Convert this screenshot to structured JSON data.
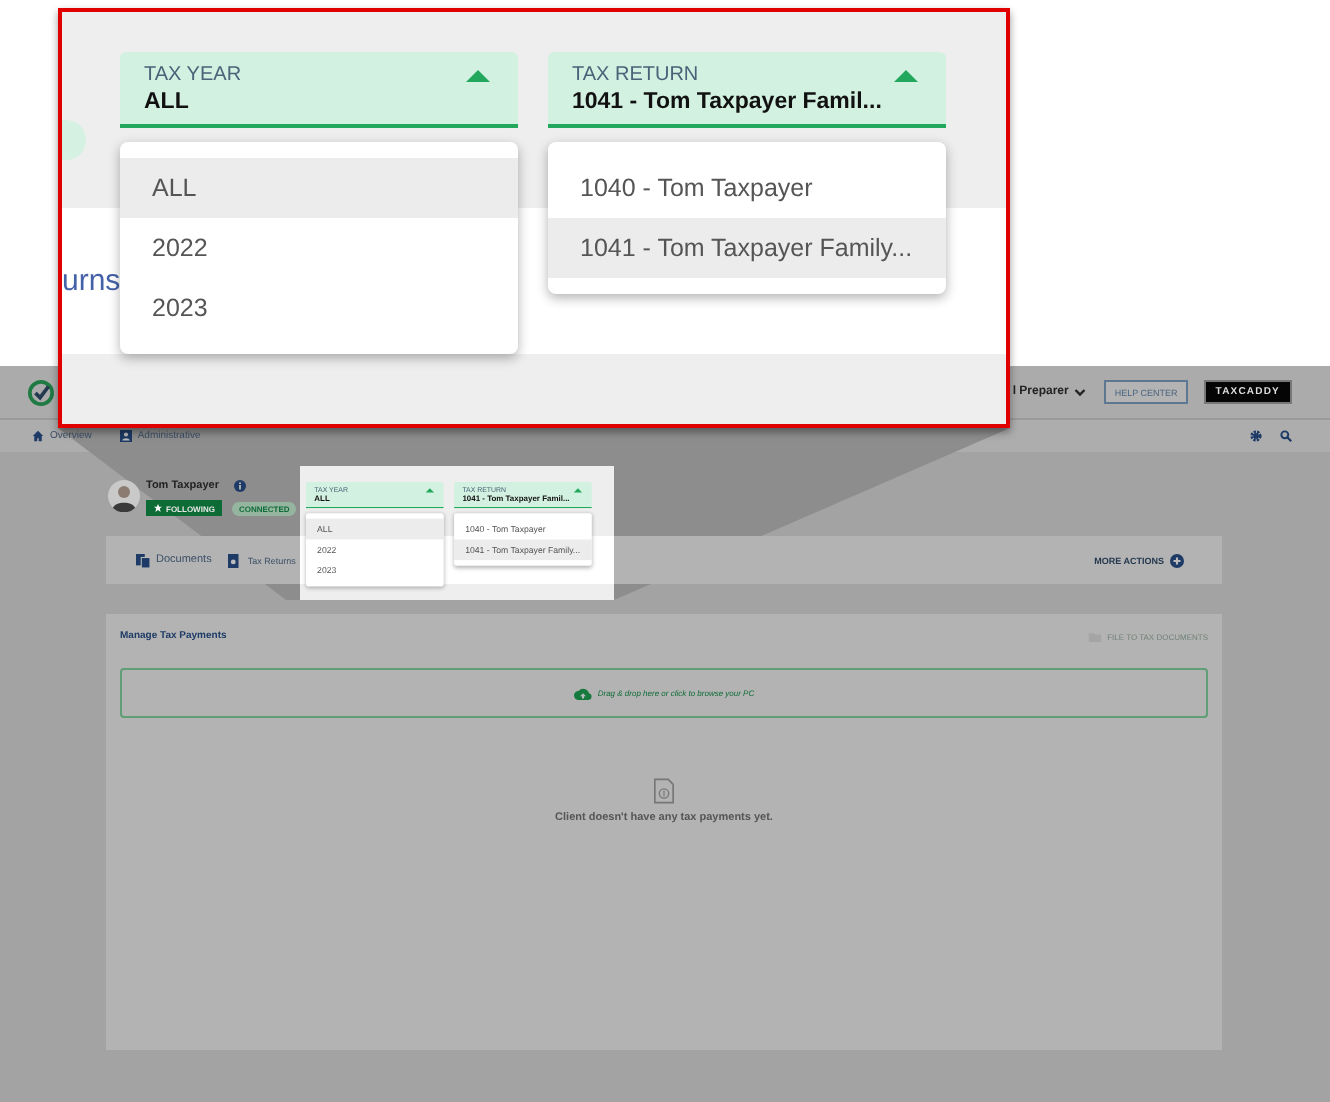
{
  "callout": {
    "tab_fragment": "urns",
    "tax_year": {
      "label": "TAX YEAR",
      "value": "ALL",
      "expanded": true,
      "options": [
        {
          "label": "ALL",
          "selected": true
        },
        {
          "label": "2022",
          "selected": false
        },
        {
          "label": "2023",
          "selected": false
        }
      ]
    },
    "tax_return": {
      "label": "TAX RETURN",
      "value": "1041 - Tom Taxpayer Famil...",
      "expanded": true,
      "options": [
        {
          "label": "1040 - Tom Taxpayer",
          "selected": false
        },
        {
          "label": "1041 - Tom Taxpayer Family...",
          "selected": true
        }
      ]
    }
  },
  "header": {
    "user_menu": "l Preparer",
    "help_button": "HELP CENTER",
    "brand_menu": "TAXCADDY"
  },
  "nav": [
    {
      "label": "Overview",
      "kind": "home"
    },
    {
      "label": "Administrative",
      "kind": "person"
    }
  ],
  "client": {
    "name": "Tom Taxpayer",
    "following": "FOLLOWING",
    "connected": "CONNECTED"
  },
  "client_tabs": [
    {
      "label": "Documents"
    },
    {
      "label": "Tax Returns"
    }
  ],
  "more_actions": "MORE ACTIONS",
  "spotlight": {
    "tax_year": {
      "label": "TAX YEAR",
      "value": "ALL",
      "expanded": true,
      "options": [
        {
          "label": "ALL",
          "selected": true
        },
        {
          "label": "2022",
          "selected": false
        },
        {
          "label": "2023",
          "selected": false
        }
      ]
    },
    "tax_return": {
      "label": "TAX RETURN",
      "value": "1041 - Tom Taxpayer Famil...",
      "expanded": true,
      "options": [
        {
          "label": "1040 - Tom Taxpayer",
          "selected": false
        },
        {
          "label": "1041 - Tom Taxpayer Family...",
          "selected": true
        }
      ]
    }
  },
  "payments": {
    "title": "Manage Tax Payments",
    "file_link": "FILE TO TAX DOCUMENTS",
    "dropzone": "Drag & drop here or click to browse your PC",
    "empty_message": "Client doesn't have any tax payments yet."
  }
}
